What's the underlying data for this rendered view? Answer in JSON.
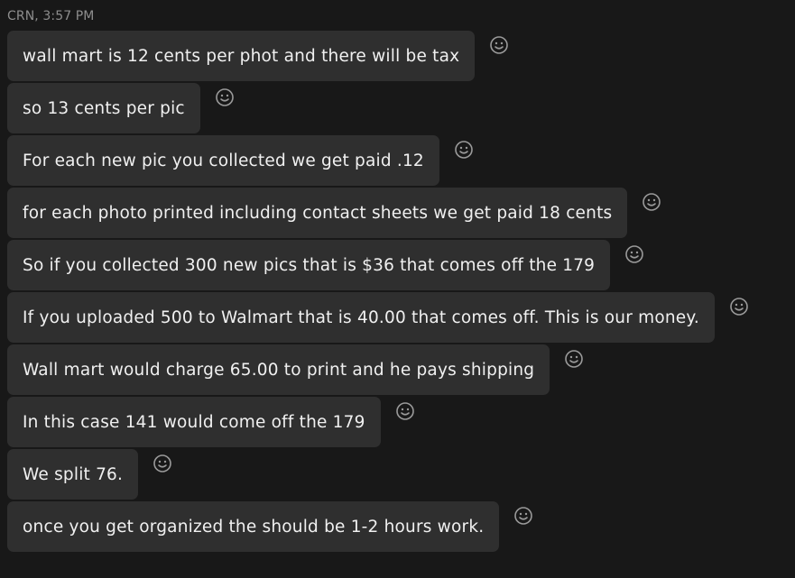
{
  "header": {
    "sender_timestamp": "CRN, 3:57 PM"
  },
  "messages": [
    {
      "text": "wall mart is 12 cents per phot and there will be tax"
    },
    {
      "text": "so 13 cents per pic"
    },
    {
      "text": "For each new pic you collected we get paid .12"
    },
    {
      "text": "for each photo printed including contact sheets we get paid 18 cents"
    },
    {
      "text": "So if you collected 300 new pics that is $36 that comes off the 179"
    },
    {
      "text": "If you uploaded 500 to Walmart that is 40.00 that comes off. This is our money."
    },
    {
      "text": "Wall mart would charge 65.00 to print and he pays shipping"
    },
    {
      "text": "In this case 141 would come off the 179"
    },
    {
      "text": "We split 76."
    },
    {
      "text": "once you get organized the should be 1-2 hours work."
    }
  ],
  "icons": {
    "reaction": "smiley-face-icon"
  },
  "colors": {
    "background": "#181818",
    "bubble": "#2f2f2f",
    "text": "#f0f0f0",
    "meta_text": "#8e8e8e",
    "icon": "#9a9a9a"
  }
}
